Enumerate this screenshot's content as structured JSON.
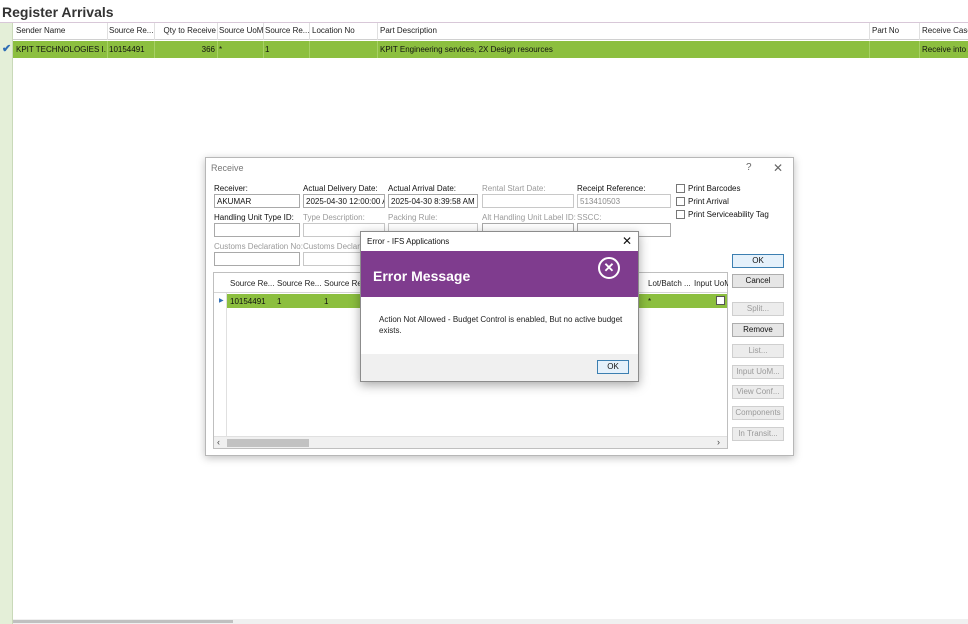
{
  "page": {
    "title": "Register Arrivals"
  },
  "grid": {
    "headers": [
      "Sender Name",
      "Source Re...",
      "Qty to Receive",
      "Source UoM",
      "Source Re...",
      "Location No",
      "Part Description",
      "Part No",
      "Receive Case"
    ],
    "row": {
      "sender_name": "KPIT TECHNOLOGIES I...",
      "source_ref": "10154491",
      "qty_to_receive": "366",
      "source_uom": "*",
      "source_ref2": "1",
      "location_no": "",
      "part_description": "KPIT Engineering services, 2X Design resources",
      "part_no": "",
      "receive_case": "Receive into A"
    }
  },
  "receive_dialog": {
    "title": "Receive",
    "help": "?",
    "close": "✕",
    "fields": {
      "receiver_label": "Receiver:",
      "receiver_value": "AKUMAR",
      "actual_delivery_label": "Actual Delivery Date:",
      "actual_delivery_value": "2025-04-30 12:00:00 AM",
      "actual_arrival_label": "Actual Arrival Date:",
      "actual_arrival_value": "2025-04-30 8:39:58 AM",
      "rental_start_label": "Rental Start Date:",
      "rental_start_value": "",
      "receipt_reference_label": "Receipt Reference:",
      "receipt_reference_value": "513410503",
      "handling_unit_type_label": "Handling Unit Type ID:",
      "type_description_label": "Type Description:",
      "packing_rule_label": "Packing Rule:",
      "alt_handling_label": "Alt Handling Unit Label ID:",
      "sscc_label": "SSCC:",
      "customs_decl_label": "Customs Declaration No:",
      "customs_decl2_label": "Customs Declara"
    },
    "checkboxes": [
      "Print Barcodes",
      "Print Arrival",
      "Print Serviceability Tag"
    ],
    "buttons": {
      "ok": "OK",
      "cancel": "Cancel",
      "split": "Split...",
      "remove": "Remove",
      "list": "List...",
      "input_uom": "Input UoM...",
      "view_conf": "View Conf...",
      "components": "Components",
      "in_transit": "In Transit..."
    },
    "inner_grid": {
      "headers": [
        "Source Re...",
        "Source Re...",
        "Source Re",
        "Lot/Batch ...",
        "Input UoM"
      ],
      "row": {
        "col1": "10154491",
        "col2": "1",
        "col3": "1",
        "lot": "*"
      }
    }
  },
  "error_dialog": {
    "title": "Error - IFS Applications",
    "close": "✕",
    "heading": "Error Message",
    "icon": "✕",
    "message": "Action Not Allowed - Budget Control is enabled, But no active budget exists.",
    "ok": "OK"
  },
  "colors": {
    "row_green": "#8cbf3f",
    "error_purple": "#7f3c8e"
  }
}
